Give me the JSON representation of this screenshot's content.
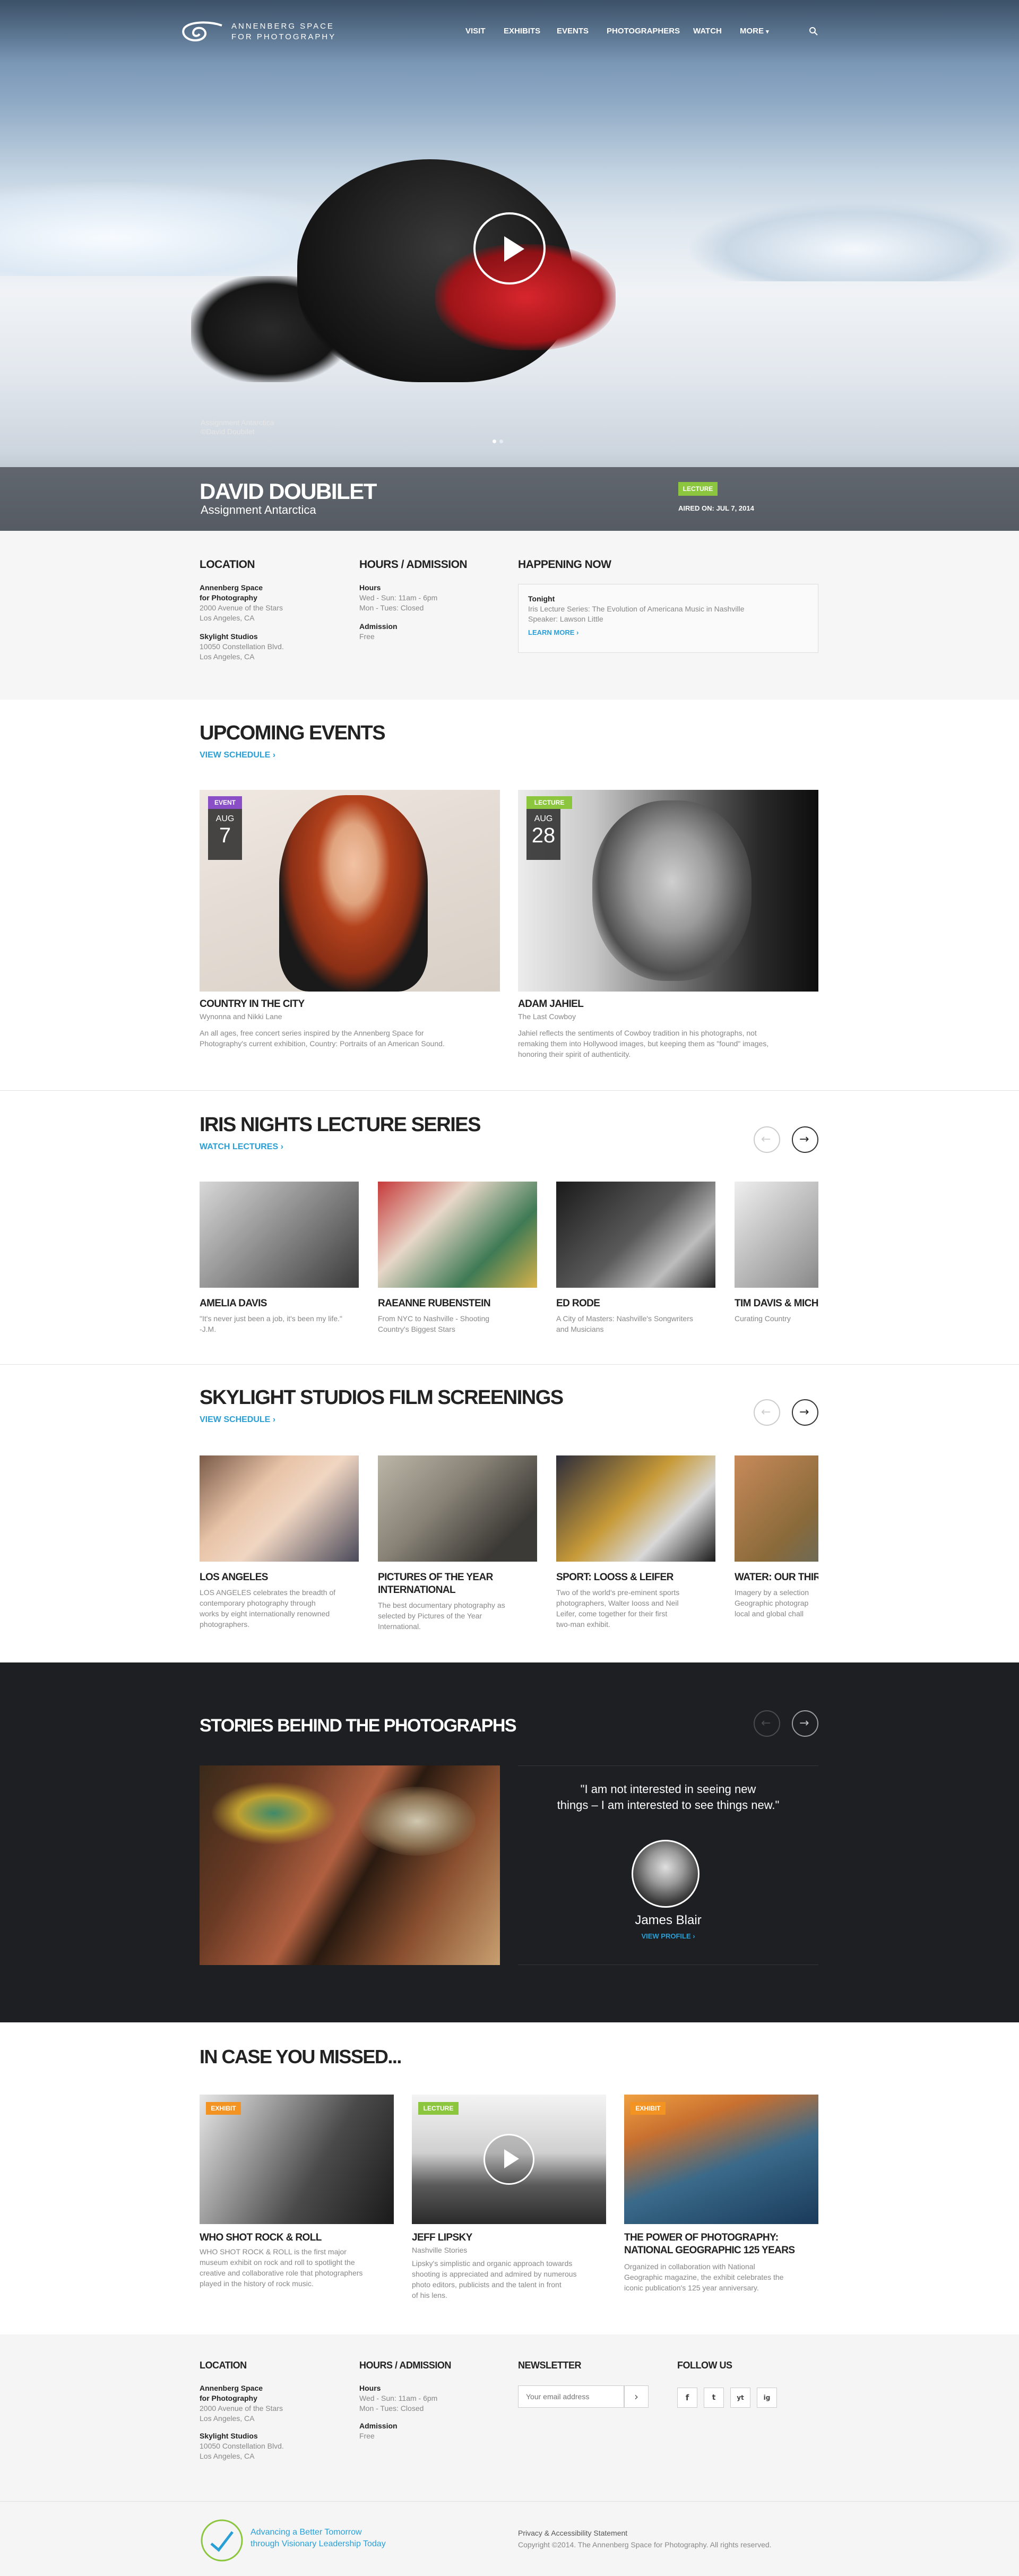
{
  "brand": {
    "line1": "ANNENBERG SPACE",
    "line2": "FOR PHOTOGRAPHY"
  },
  "nav": {
    "items": [
      "VISIT",
      "EXHIBITS",
      "EVENTS",
      "PHOTOGRAPHERS",
      "WATCH",
      "MORE"
    ],
    "more_caret": "▾"
  },
  "hero": {
    "credit_title": "Assignment Antarctica",
    "credit_name": "©David Doubilet",
    "title": "DAVID DOUBILET",
    "subtitle": "Assignment Antarctica",
    "tag": "LECTURE",
    "aired": "AIRED ON: JUL 7, 2014"
  },
  "info": {
    "location": {
      "heading": "LOCATION",
      "venue1_name1": "Annenberg Space",
      "venue1_name2": "for Photography",
      "venue1_addr1": "2000 Avenue of the Stars",
      "venue1_addr2": "Los Angeles, CA",
      "venue2_name": "Skylight Studios",
      "venue2_addr1": "10050 Constellation Blvd.",
      "venue2_addr2": "Los Angeles, CA"
    },
    "hours": {
      "heading": "HOURS / ADMISSION",
      "hours_label": "Hours",
      "hours1": "Wed - Sun: 11am - 6pm",
      "hours2": "Mon - Tues: Closed",
      "admission_label": "Admission",
      "admission": "Free"
    },
    "happening": {
      "heading": "HAPPENING NOW",
      "label": "Tonight",
      "line1": "Iris Lecture Series: The Evolution of Americana Music in Nashville",
      "line2": "Speaker: Lawson Little",
      "link": "LEARN MORE ›"
    }
  },
  "upcoming": {
    "heading": "UPCOMING EVENTS",
    "link": "VIEW SCHEDULE ›",
    "cards": [
      {
        "tag": "EVENT",
        "tag_color": "#8a4fc6",
        "month": "AUG",
        "day": "7",
        "title": "COUNTRY IN THE CITY",
        "sub": "Wynonna and Nikki Lane",
        "desc1": "An all ages, free concert series inspired by the Annenberg Space for",
        "desc2": "Photography's current exhibition, Country: Portraits of an American Sound."
      },
      {
        "tag": "LECTURE",
        "tag_color": "#8cc63f",
        "month": "AUG",
        "day": "28",
        "title": "ADAM JAHIEL",
        "sub": "The Last Cowboy",
        "desc1": "Jahiel reflects the sentiments of Cowboy tradition in his photographs, not",
        "desc2": "remaking them into Hollywood images, but keeping them as \"found\" images,",
        "desc3": "honoring their spirit of authenticity."
      }
    ]
  },
  "iris": {
    "heading": "IRIS NIGHTS LECTURE SERIES",
    "link": "WATCH LECTURES ›",
    "items": [
      {
        "title": "AMELIA DAVIS",
        "d1": "\"It's never just been a job, it's been my life.\"",
        "d2": "-J.M."
      },
      {
        "title": "RAEANNE RUBENSTEIN",
        "d1": "From NYC to Nashville - Shooting",
        "d2": "Country's Biggest Stars"
      },
      {
        "title": "ED RODE",
        "d1": "A City of Masters: Nashville's Songwriters",
        "d2": "and Musicians"
      },
      {
        "title": "TIM DAVIS & MICHAEL",
        "d1": "Curating Country",
        "d2": ""
      }
    ]
  },
  "skylight": {
    "heading": "SKYLIGHT STUDIOS FILM SCREENINGS",
    "link": "VIEW SCHEDULE ›",
    "items": [
      {
        "title": "LOS ANGELES",
        "d1": "LOS ANGELES celebrates the breadth of",
        "d2": "contemporary photography through",
        "d3": "works by eight internationally renowned",
        "d4": "photographers."
      },
      {
        "title": "PICTURES OF THE YEAR",
        "title2": "INTERNATIONAL",
        "d1": "The best documentary photography as",
        "d2": "selected by Pictures of the Year",
        "d3": "International."
      },
      {
        "title": "SPORT: LOOSS & LEIFER",
        "d1": "Two of the world's pre-eminent sports",
        "d2": "photographers, Walter Iooss and Neil",
        "d3": "Leifer, come together for their first",
        "d4": "two-man exhibit."
      },
      {
        "title": "WATER: OUR THIRSTY",
        "d1": "Imagery by a selection",
        "d2": "Geographic photograp",
        "d3": "local and global chall"
      }
    ]
  },
  "stories": {
    "heading": "STORIES BEHIND THE PHOTOGRAPHS",
    "quote1": "\"I am not interested in seeing new",
    "quote2": "things – I am interested to see things new.\"",
    "name": "James Blair",
    "link": "VIEW PROFILE ›"
  },
  "missed": {
    "heading": "IN CASE YOU MISSED...",
    "cards": [
      {
        "tag": "EXHIBIT",
        "tag_color": "#f39322",
        "title": "WHO SHOT ROCK & ROLL",
        "sub": "",
        "d1": "WHO SHOT ROCK & ROLL is the first major",
        "d2": "museum exhibit on rock and roll to spotlight the",
        "d3": "creative and collaborative role that photographers",
        "d4": "played in the history of rock music."
      },
      {
        "tag": "LECTURE",
        "tag_color": "#8cc63f",
        "title": "JEFF LIPSKY",
        "sub": "Nashville Stories",
        "d1": "Lipsky's simplistic and organic approach towards",
        "d2": "shooting is appreciated and admired by numerous",
        "d3": "photo editors, publicists and the talent in front",
        "d4": "of his lens."
      },
      {
        "tag": "EXHIBIT",
        "tag_color": "#f39322",
        "title": "THE POWER OF PHOTOGRAPHY:",
        "title2": "NATIONAL GEOGRAPHIC 125 YEARS",
        "d1": "Organized in collaboration with National",
        "d2": "Geographic magazine, the exhibit celebrates the",
        "d3": "iconic publication's 125 year anniversary."
      }
    ]
  },
  "footer": {
    "newsletter_heading": "NEWSLETTER",
    "newsletter_placeholder": "Your email address",
    "newsletter_btn": "›",
    "follow_heading": "FOLLOW US",
    "social": [
      "f",
      "t",
      "yt",
      "ig"
    ],
    "tagline1": "Advancing a Better Tomorrow",
    "tagline2": "through Visionary Leadership Today",
    "privacy": "Privacy & Accessibility Statement",
    "copyright": "Copyright ©2014. The Annenberg Space for Photography. All rights reserved."
  },
  "colors": {
    "accent": "#2a9fd6",
    "dark_band": "#1d1f22",
    "footer_bg": "#f5f5f5"
  }
}
